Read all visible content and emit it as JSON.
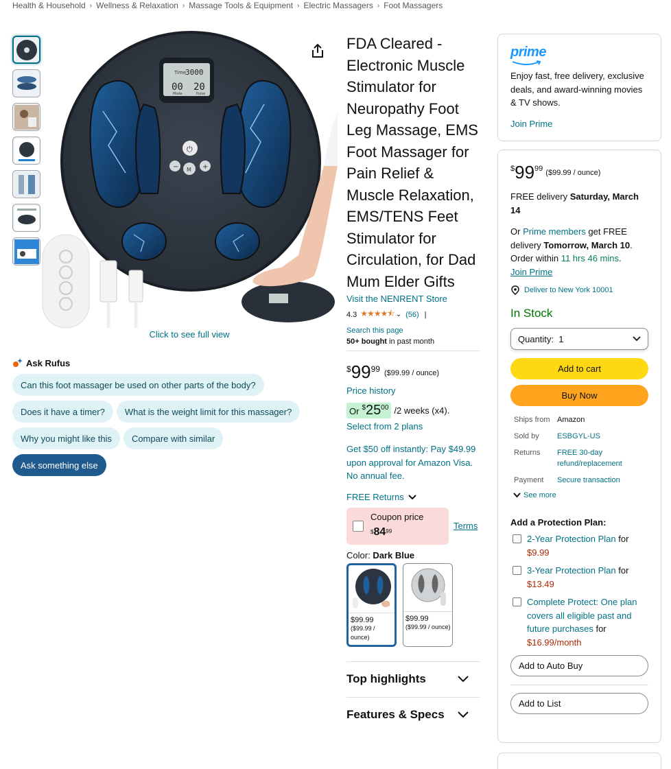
{
  "breadcrumb": [
    "Health & Household",
    "Wellness & Relaxation",
    "Massage Tools & Equipment",
    "Electric Massagers",
    "Foot Massagers"
  ],
  "image": {
    "full_view": "Click to see full view",
    "lcd_time_label": "Time",
    "lcd_time_value": "3000",
    "lcd_left": "00",
    "lcd_right": "20",
    "lcd_mode": "Mode",
    "lcd_pulse": "Pulse",
    "center_button": "M"
  },
  "rufus": {
    "title": "Ask Rufus",
    "chips": [
      "Can this foot massager be used on other parts of the body?",
      "Does it have a timer?",
      "What is the weight limit for this massager?",
      "Why you might like this",
      "Compare with similar",
      "Ask something else"
    ]
  },
  "product": {
    "title": "FDA Cleared - Electronic Muscle Stimulator for Neuropathy Foot Leg Massage, EMS Foot Massager for Pain Relief & Muscle Relaxation, EMS/TENS Feet Stimulator for Circulation, for Dad Mum Elder Gifts",
    "store": "Visit the NENRENT Store",
    "rating": "4.3",
    "stars": "★★★★⯪",
    "reviews": "(56)",
    "rating_sep": "|",
    "search_page": "Search this page",
    "bought_bold": "50+ bought",
    "bought_rest": " in past month",
    "price_symbol": "$",
    "price_whole": "99",
    "price_fraction": "99",
    "price_unit": "($99.99 / ounce)",
    "price_history": "Price history",
    "installment_or": "Or",
    "installment_symbol": "$",
    "installment_whole": "25",
    "installment_fraction": "00",
    "installment_period": "/2 weeks (x4).",
    "plans": "Select from 2 plans",
    "visa": "Get $50 off instantly: Pay $49.99 upon approval for Amazon Visa. No annual fee.",
    "free_returns": "FREE Returns",
    "coupon_label": "Coupon price",
    "coupon_symbol": "$",
    "coupon_whole": "84",
    "coupon_fraction": "99",
    "terms": "Terms",
    "color_label": "Color:",
    "color_value": "Dark Blue",
    "swatches": [
      {
        "price": "$99.99",
        "unit": "($99.99 / ounce)"
      },
      {
        "price": "$99.99",
        "unit": "($99.99 / ounce)"
      }
    ],
    "accordions": [
      "Top highlights",
      "Features & Specs"
    ]
  },
  "prime_card": {
    "logo": "prime",
    "text": "Enjoy fast, free delivery, exclusive deals, and award-winning movies & TV shows.",
    "join": "Join Prime"
  },
  "buy_box": {
    "price_symbol": "$",
    "price_whole": "99",
    "price_fraction": "99",
    "price_unit": "($99.99 / ounce)",
    "delivery_prefix": "FREE delivery ",
    "delivery_date": "Saturday, March 14",
    "or": "Or ",
    "prime_members": "Prime members",
    "get_free": " get FREE delivery ",
    "fast_date": "Tomorrow, March 10",
    "order_within": ". Order within ",
    "countdown": "11 hrs 46 mins",
    "period": ".",
    "join_prime": "Join Prime",
    "deliver_to": "Deliver to New York 10001",
    "stock": "In Stock",
    "quantity_label": "Quantity:",
    "quantity_value": "1",
    "add_to_cart": "Add to cart",
    "buy_now": "Buy Now",
    "details": [
      {
        "key": "Ships from",
        "value": "Amazon",
        "link": false
      },
      {
        "key": "Sold by",
        "value": "ESBGYL-US",
        "link": true
      },
      {
        "key": "Returns",
        "value": "FREE 30-day refund/replacement",
        "link": true
      },
      {
        "key": "Payment",
        "value": "Secure transaction",
        "link": true
      }
    ],
    "see_more": "See more",
    "protection_title": "Add a Protection Plan:",
    "plans": [
      {
        "name": "2-Year Protection Plan",
        "for": " for ",
        "price": "$9.99"
      },
      {
        "name": "3-Year Protection Plan",
        "for": " for ",
        "price": "$13.49"
      },
      {
        "name": "Complete Protect: One plan covers all eligible past and future purchases",
        "for": " for ",
        "price": "$16.99/month"
      }
    ],
    "auto_buy": "Add to Auto Buy",
    "add_to_list": "Add to List"
  }
}
